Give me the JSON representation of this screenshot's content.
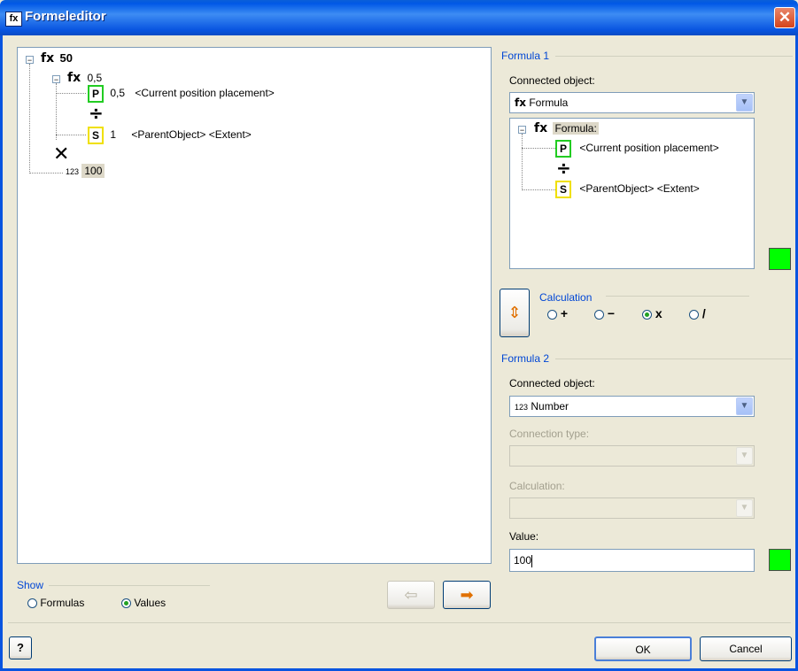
{
  "window": {
    "title": "Formeleditor",
    "title_icon": "fx",
    "close_glyph": "✕"
  },
  "tree": {
    "root": {
      "icon": "fx",
      "value": "50"
    },
    "child": {
      "icon": "fx",
      "value": "0,5"
    },
    "p_item": {
      "badge": "P",
      "value": "0,5",
      "label": "<Current position placement>"
    },
    "s_item": {
      "badge": "S",
      "value": "1",
      "label": "<ParentObject> <Extent>"
    },
    "number": {
      "icon": "123",
      "value": "100"
    }
  },
  "formula1": {
    "group_label": "Formula 1",
    "connected_label": "Connected object:",
    "connected_value": "Formula",
    "connected_icon": "fx",
    "tree": {
      "root_icon": "fx",
      "root_label": "Formula:",
      "p_badge": "P",
      "p_label": "<Current position placement>",
      "s_badge": "S",
      "s_label": "<ParentObject> <Extent>"
    },
    "status_color": "#00ff00"
  },
  "calculation": {
    "group_label": "Calculation",
    "options": [
      {
        "symbol": "+",
        "selected": false
      },
      {
        "symbol": "−",
        "selected": false
      },
      {
        "symbol": "x",
        "selected": true
      },
      {
        "symbol": "/",
        "selected": false
      }
    ],
    "swap_icon": "⇕"
  },
  "formula2": {
    "group_label": "Formula 2",
    "connected_label": "Connected object:",
    "connected_value": "Number",
    "connected_icon": "123",
    "connection_type_label": "Connection type:",
    "calculation_label": "Calculation:",
    "value_label": "Value:",
    "value": "100",
    "status_color": "#00ff00"
  },
  "show": {
    "group_label": "Show",
    "options": [
      {
        "label": "Formulas",
        "selected": false
      },
      {
        "label": "Values",
        "selected": true
      }
    ]
  },
  "nav": {
    "back_icon": "⇦",
    "forward_icon": "➡"
  },
  "footer": {
    "help_label": "?",
    "ok_label": "OK",
    "cancel_label": "Cancel"
  }
}
